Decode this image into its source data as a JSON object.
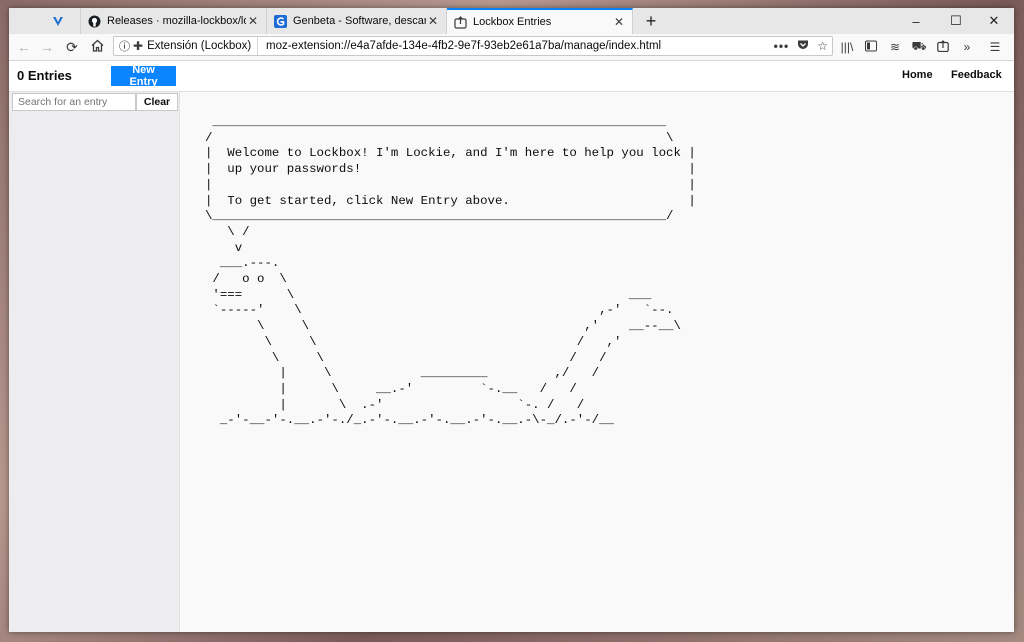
{
  "tabs": [
    {
      "title": "",
      "favicon": "v-icon",
      "active": false
    },
    {
      "title": "Releases · mozilla-lockbox/lockb",
      "favicon": "github-icon",
      "active": false
    },
    {
      "title": "Genbeta - Software, descargas,",
      "favicon": "genbeta-icon",
      "active": false
    },
    {
      "title": "Lockbox Entries",
      "favicon": "lockbox-icon",
      "active": true
    }
  ],
  "window_controls": {
    "minimize": "–",
    "maximize": "☐",
    "close": "✕"
  },
  "urlbar": {
    "identity_label": "Extensión (Lockbox)",
    "url": "moz-extension://e4a7afde-134e-4fb2-9e7f-93eb2e61a7ba/manage/index.html"
  },
  "app": {
    "entry_count": "0 Entries",
    "new_entry_label": "New Entry",
    "home_label": "Home",
    "feedback_label": "Feedback",
    "search_placeholder": "Search for an entry",
    "clear_label": "Clear"
  },
  "lockie_art": " _____________________________________________________________\n/                                                             \\\n|  Welcome to Lockbox! I'm Lockie, and I'm here to help you lock |\n|  up your passwords!                                            |\n|                                                                |\n|  To get started, click New Entry above.                        |\n\\_____________________________________________________________/\n   \\ /\n    v\n  ___.---.\n /   o o  \\\n '===      \\                                             ___\n `-----'    \\                                        ,-'   `--.\n       \\     \\                                     ,'    __--__\\\n        \\     \\                                   /   ,'\n         \\     \\                                 /   /\n          |     \\            _________         ,/   /\n          |      \\     __.-'         `-.__   /   /\n          |       \\  .-'                  `-. /   /\n  _-'-__-'-.__.-'-./_.-'-.__.-'-.__.-'-.__.-\\-_/.-'-/__"
}
